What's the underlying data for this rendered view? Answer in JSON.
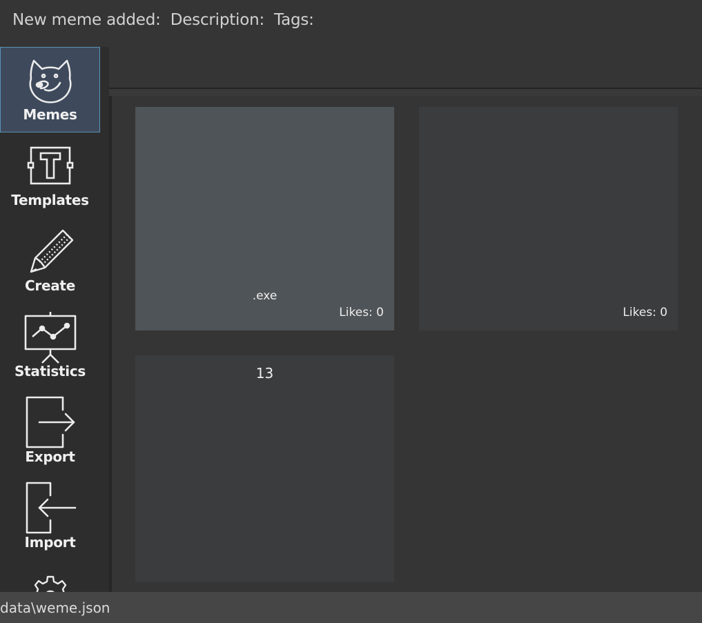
{
  "header": {
    "new_meme_label": "New meme added:",
    "description_label": "Description:",
    "tags_label": "Tags:"
  },
  "sidebar": {
    "items": [
      {
        "label": "Memes",
        "icon": "doge-icon",
        "active": true
      },
      {
        "label": "Templates",
        "icon": "text-template-icon",
        "active": false
      },
      {
        "label": "Create",
        "icon": "pencil-icon",
        "active": false
      },
      {
        "label": "Statistics",
        "icon": "chart-board-icon",
        "active": false
      },
      {
        "label": "Export",
        "icon": "export-icon",
        "active": false
      },
      {
        "label": "Import",
        "icon": "import-icon",
        "active": false
      },
      {
        "label": "",
        "icon": "gear-icon",
        "active": false
      }
    ]
  },
  "memes": [
    {
      "title": ".exe",
      "likes": "Likes: 0"
    },
    {
      "title": "",
      "likes": "Likes: 0"
    },
    {
      "title": "13",
      "likes": ""
    }
  ],
  "statusbar": {
    "path": "data\\weme.json"
  },
  "colors": {
    "background": "#353535",
    "sidebar": "#2d2d2d",
    "active_item": "#3e4a5c",
    "active_border": "#5a93b5",
    "card": "#3b3c3e",
    "card_hover": "#4f5458",
    "statusbar": "#464646"
  }
}
